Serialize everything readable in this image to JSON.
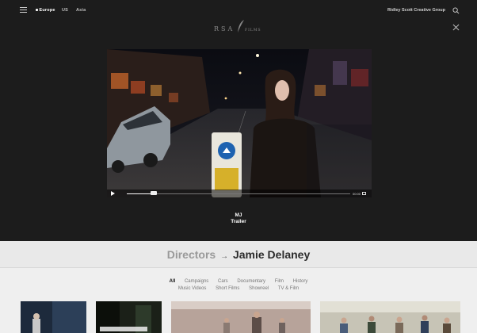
{
  "nav": {
    "regions": [
      "Europe",
      "US",
      "Asia"
    ],
    "active_region": "Europe",
    "group_link": "Ridley Scott Creative Group"
  },
  "logo": {
    "mark": "RSA",
    "sub": "FILMS"
  },
  "video": {
    "time_elapsed": "00:00",
    "progress": 0.12
  },
  "caption": {
    "title": "MJ",
    "subtitle": "Trailer"
  },
  "directors": {
    "crumb": "Directors",
    "arrow": "→",
    "name": "Jamie Delaney"
  },
  "filters": {
    "row1": [
      "All",
      "Campaigns",
      "Cars",
      "Documentary",
      "Film",
      "History"
    ],
    "row2": [
      "Music Videos",
      "Short Films",
      "Showreel",
      "TV & Film"
    ],
    "active": "All"
  },
  "colors": {
    "dark_bg": "#1c1c1c",
    "light_bg": "#efefef"
  }
}
